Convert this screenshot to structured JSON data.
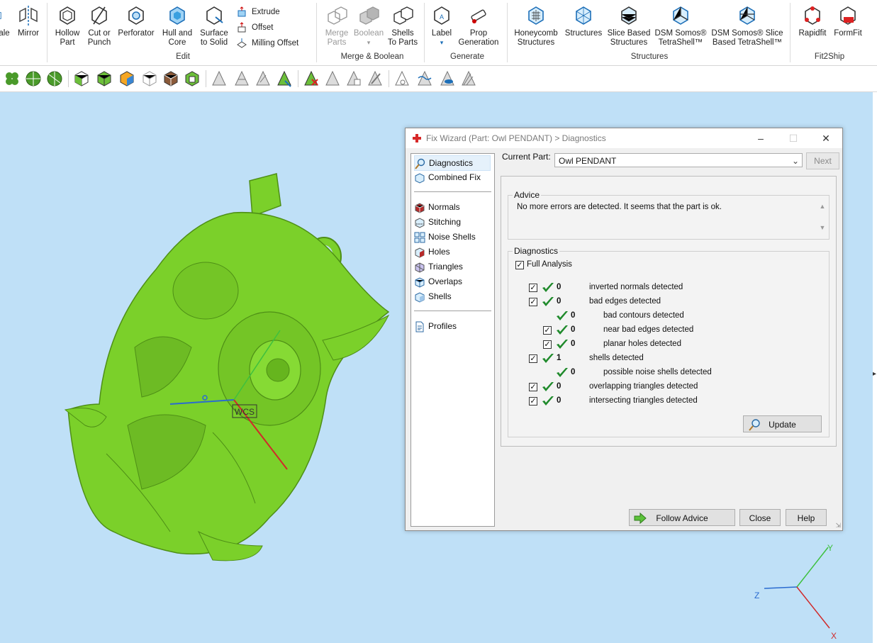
{
  "ribbon": {
    "left_partial": [
      {
        "label": "ale"
      },
      {
        "label": "Mirror"
      }
    ],
    "edit": {
      "buttons": [
        {
          "label": "Hollow\nPart",
          "l1": "Hollow",
          "l2": "Part",
          "icon": "hollow-part-icon"
        },
        {
          "label": "Cut or Punch",
          "l1": "Cut or",
          "l2": "Punch",
          "icon": "cut-punch-icon"
        },
        {
          "label": "Perforator",
          "l1": "Perforator",
          "l2": "",
          "icon": "perforator-icon"
        },
        {
          "label": "Hull and Core",
          "l1": "Hull and",
          "l2": "Core",
          "icon": "hull-core-icon"
        },
        {
          "label": "Surface to Solid",
          "l1": "Surface",
          "l2": "to Solid",
          "icon": "surface-solid-icon"
        }
      ],
      "small": [
        "Extrude",
        "Offset",
        "Milling Offset"
      ],
      "group_label": "Edit"
    },
    "merge": {
      "buttons": [
        {
          "l1": "Merge",
          "l2": "Parts"
        },
        {
          "l1": "Boolean",
          "l2": ""
        },
        {
          "l1": "Shells",
          "l2": "To Parts"
        }
      ],
      "group_label": "Merge & Boolean"
    },
    "generate": {
      "buttons": [
        {
          "l1": "Label",
          "l2": ""
        },
        {
          "l1": "Prop",
          "l2": "Generation"
        }
      ],
      "group_label": "Generate"
    },
    "structures": {
      "buttons": [
        {
          "l1": "Honeycomb",
          "l2": "Structures"
        },
        {
          "l1": "Structures",
          "l2": ""
        },
        {
          "l1": "Slice Based",
          "l2": "Structures"
        },
        {
          "l1": "DSM Somos®",
          "l2": "TetraShell™"
        },
        {
          "l1": "DSM Somos® Slice",
          "l2": "Based TetraShell™"
        }
      ],
      "group_label": "Structures"
    },
    "fit2ship": {
      "buttons": [
        {
          "l1": "Rapidfit",
          "l2": ""
        },
        {
          "l1": "FormFit",
          "l2": ""
        }
      ],
      "group_label": "Fit2Ship"
    }
  },
  "viewport": {
    "wcs_label": "WCS",
    "axis": {
      "x": "X",
      "y": "Y",
      "z": "Z"
    },
    "model_color": "#7bd02a",
    "background": "#bfe0f7"
  },
  "dialog": {
    "title": "Fix Wizard (Part: Owl  PENDANT) > Diagnostics",
    "nav": {
      "top": [
        "Diagnostics",
        "Combined Fix"
      ],
      "middle": [
        "Normals",
        "Stitching",
        "Noise Shells",
        "Holes",
        "Triangles",
        "Overlaps",
        "Shells"
      ],
      "bottom": [
        "Profiles"
      ],
      "selected": "Diagnostics"
    },
    "current_part_label": "Current Part:",
    "current_part_value": "Owl  PENDANT",
    "next_label": "Next",
    "advice_legend": "Advice",
    "advice_text": "No more errors are detected. It seems that the part is ok.",
    "diagnostics_legend": "Diagnostics",
    "full_analysis_label": "Full Analysis",
    "full_analysis_checked": true,
    "rows": [
      {
        "text": "inverted normals detected",
        "count": "0",
        "indent": 0,
        "checkbox": true
      },
      {
        "text": "bad edges detected",
        "count": "0",
        "indent": 0,
        "checkbox": true
      },
      {
        "text": "bad contours detected",
        "count": "0",
        "indent": 1,
        "checkbox": false
      },
      {
        "text": "near bad edges detected",
        "count": "0",
        "indent": 1,
        "checkbox": true
      },
      {
        "text": "planar holes detected",
        "count": "0",
        "indent": 1,
        "checkbox": true
      },
      {
        "text": "shells detected",
        "count": "1",
        "indent": 0,
        "checkbox": true
      },
      {
        "text": "possible noise shells detected",
        "count": "0",
        "indent": 1,
        "checkbox": false
      },
      {
        "text": "overlapping triangles detected",
        "count": "0",
        "indent": 0,
        "checkbox": true
      },
      {
        "text": "intersecting triangles detected",
        "count": "0",
        "indent": 0,
        "checkbox": true
      }
    ],
    "update_label": "Update",
    "follow_advice_label": "Follow Advice",
    "close_label": "Close",
    "help_label": "Help"
  }
}
